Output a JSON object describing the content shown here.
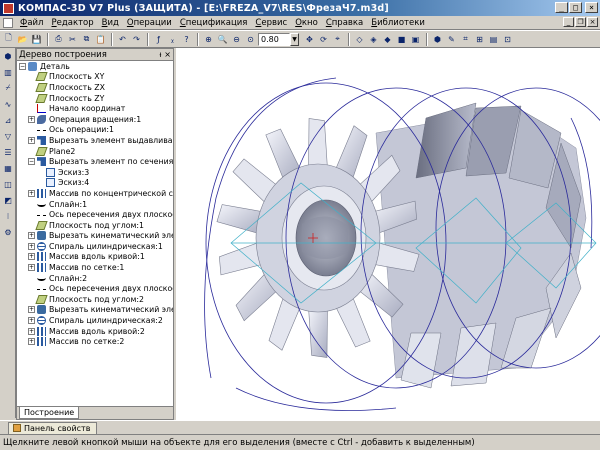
{
  "window": {
    "title": "КОМПАС-3D V7 Plus (ЗАЩИТА) - [E:\\FREZA_V7\\RES\\ФрезаЧ7.m3d]",
    "minimize": "_",
    "maximize": "□",
    "close": "×"
  },
  "menu": {
    "items": [
      {
        "accel": "Ф",
        "rest": "айл"
      },
      {
        "accel": "Р",
        "rest": "едактор"
      },
      {
        "accel": "В",
        "rest": "ид"
      },
      {
        "accel": "О",
        "rest": "перации"
      },
      {
        "accel": "С",
        "rest": "пецификация"
      },
      {
        "accel": "С",
        "rest": "ервис"
      },
      {
        "accel": "О",
        "rest": "кно"
      },
      {
        "accel": "С",
        "rest": "правка"
      },
      {
        "accel": "Б",
        "rest": "иблиотеки"
      }
    ]
  },
  "toolbar": {
    "zoom_value": "0.80",
    "zoom_dropdown": "▼"
  },
  "tree": {
    "header": "Дерево построения",
    "pin": "ᵼ",
    "close": "×",
    "items": [
      {
        "label": "Деталь",
        "icon": "part-icon",
        "expander": "−",
        "level": 0
      },
      {
        "label": "Плоскость XY",
        "icon": "plane-icon",
        "expander": "",
        "level": 1
      },
      {
        "label": "Плоскость ZX",
        "icon": "plane-icon",
        "expander": "",
        "level": 1
      },
      {
        "label": "Плоскость ZY",
        "icon": "plane-icon",
        "expander": "",
        "level": 1
      },
      {
        "label": "Начало координат",
        "icon": "origin-icon",
        "expander": "",
        "level": 1
      },
      {
        "label": "Операция вращения:1",
        "icon": "revolve-icon",
        "expander": "+",
        "level": 1
      },
      {
        "label": "Ось операции:1",
        "icon": "axis-icon",
        "expander": "",
        "level": 1
      },
      {
        "label": "Вырезать элемент выдавливания",
        "icon": "cut-icon",
        "expander": "+",
        "level": 1
      },
      {
        "label": "Plane2",
        "icon": "plane-icon",
        "expander": "",
        "level": 1
      },
      {
        "label": "Вырезать элемент по сечениям:",
        "icon": "cut-icon",
        "expander": "−",
        "level": 1
      },
      {
        "label": "Эскиз:3",
        "icon": "sketch-icon",
        "expander": "",
        "level": 2
      },
      {
        "label": "Эскиз:4",
        "icon": "sketch-icon",
        "expander": "",
        "level": 2
      },
      {
        "label": "Массив по концентрической сетк",
        "icon": "array-icon",
        "expander": "+",
        "level": 1
      },
      {
        "label": "Сплайн:1",
        "icon": "spline-icon",
        "expander": "",
        "level": 1
      },
      {
        "label": "Ось пересечения двух плоскост",
        "icon": "axis-icon",
        "expander": "",
        "level": 1
      },
      {
        "label": "Плоскость под углом:1",
        "icon": "plane-icon",
        "expander": "",
        "level": 1
      },
      {
        "label": "Вырезать кинематический элем",
        "icon": "sweep-icon",
        "expander": "+",
        "level": 1
      },
      {
        "label": "Спираль цилиндрическая:1",
        "icon": "spiral-icon",
        "expander": "+",
        "level": 1
      },
      {
        "label": "Массив вдоль кривой:1",
        "icon": "array-icon",
        "expander": "+",
        "level": 1
      },
      {
        "label": "Массив по сетке:1",
        "icon": "array-icon",
        "expander": "+",
        "level": 1
      },
      {
        "label": "Сплайн:2",
        "icon": "spline-icon",
        "expander": "",
        "level": 1
      },
      {
        "label": "Ось пересечения двух плоскост",
        "icon": "axis-icon",
        "expander": "",
        "level": 1
      },
      {
        "label": "Плоскость под углом:2",
        "icon": "plane-icon",
        "expander": "",
        "level": 1
      },
      {
        "label": "Вырезать кинематический элем",
        "icon": "sweep-icon",
        "expander": "+",
        "level": 1
      },
      {
        "label": "Спираль цилиндрическая:2",
        "icon": "spiral-icon",
        "expander": "+",
        "level": 1
      },
      {
        "label": "Массив вдоль кривой:2",
        "icon": "array-icon",
        "expander": "+",
        "level": 1
      },
      {
        "label": "Массив по сетке:2",
        "icon": "array-icon",
        "expander": "+",
        "level": 1
      }
    ],
    "tab": "Построение"
  },
  "properties_panel": {
    "tab": "Панель свойств"
  },
  "status": {
    "text": "Щелкните левой кнопкой мыши на объекте для его выделения (вместе с Ctrl - добавить к выделенным)"
  },
  "colors": {
    "titlebar_start": "#0a246a",
    "chrome": "#d4d0c8",
    "model_face": "#d8dbe8",
    "wire_blue": "#2a2a9a",
    "wire_cyan": "#40b0c8"
  }
}
